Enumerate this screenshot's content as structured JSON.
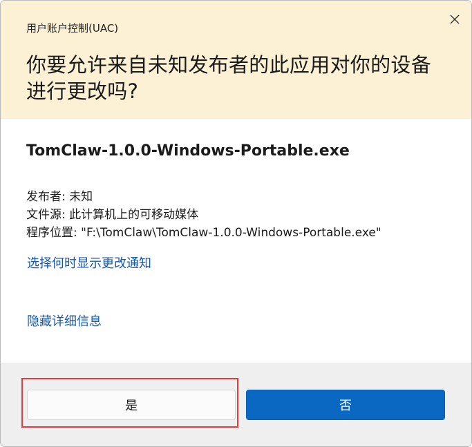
{
  "window": {
    "title": "用户账户控制(UAC)",
    "close_icon": "close-icon"
  },
  "prompt": {
    "question": "你要允许来自未知发布者的此应用对你的设备进行更改吗?"
  },
  "app": {
    "name": "TomClaw-1.0.0-Windows-Portable.exe"
  },
  "details": {
    "publisher": "发布者: 未知",
    "file_origin": "文件源: 此计算机上的可移动媒体",
    "program_location": "程序位置: \"F:\\TomClaw\\TomClaw-1.0.0-Windows-Portable.exe\""
  },
  "links": {
    "change_notify": "选择何时显示更改通知",
    "hide_details": "隐藏详细信息"
  },
  "buttons": {
    "yes": "是",
    "no": "否"
  },
  "colors": {
    "header_bg": "#fcf1d4",
    "link": "#1558b0",
    "primary_button": "#0a67c2",
    "highlight": "#e53d3d"
  }
}
